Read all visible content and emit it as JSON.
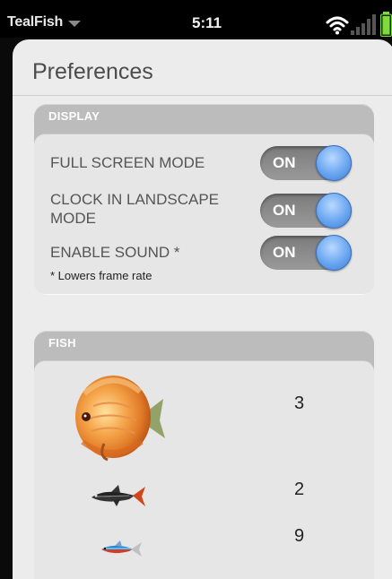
{
  "status_bar": {
    "app_name": "TealFish",
    "time": "5:11",
    "icons": [
      "menu-caret-icon",
      "wifi-icon",
      "signal-icon",
      "battery-icon"
    ],
    "battery_color": "#7ddc3a"
  },
  "page": {
    "title": "Preferences"
  },
  "display": {
    "header": "DISPLAY",
    "rows": [
      {
        "label": "FULL SCREEN MODE",
        "toggle": "ON"
      },
      {
        "label": "CLOCK IN LANDSCAPE MODE",
        "toggle": "ON"
      },
      {
        "label": "ENABLE SOUND *",
        "toggle": "ON"
      }
    ],
    "footnote": "* Lowers frame rate"
  },
  "fish": {
    "header": "FISH",
    "items": [
      {
        "icon": "discus-fish-icon",
        "count": "3"
      },
      {
        "icon": "black-tetra-fish-icon",
        "count": "2"
      },
      {
        "icon": "neon-tetra-fish-icon",
        "count": "9"
      }
    ]
  },
  "colors": {
    "toggle_knob": "#6aa6f0",
    "group_header": "#bcbcbc",
    "card_bg": "#ececec"
  }
}
